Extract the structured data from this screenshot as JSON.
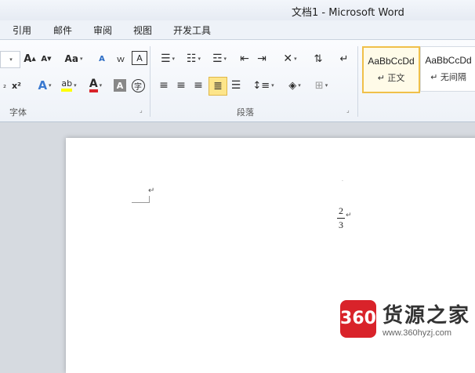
{
  "window": {
    "title": "文档1 - Microsoft Word"
  },
  "tabs": [
    "引用",
    "邮件",
    "审阅",
    "视图",
    "开发工具"
  ],
  "ribbon": {
    "font_group": {
      "label": "字体",
      "grow_font": "A",
      "shrink_font": "A",
      "change_case": "Aa",
      "superscript": "x²",
      "subscript": "₂",
      "font_color": "A",
      "char_shading": "A",
      "enclose_char": "字"
    },
    "paragraph_group": {
      "label": "段落"
    },
    "styles": [
      {
        "sample": "AaBbCcDd",
        "name": "正文"
      },
      {
        "sample": "AaBbCcDd",
        "name": "无间隔"
      }
    ]
  },
  "document": {
    "fraction": {
      "numerator": "2",
      "denominator": "3"
    },
    "paragraph_mark": "↵"
  },
  "watermark": {
    "badge": "360",
    "brand": "货源之家",
    "url": "www.360hyzj.com"
  },
  "colors": {
    "accent": "#f0c04a",
    "highlight_yellow": "#ffff00",
    "font_red": "#d9232a"
  }
}
